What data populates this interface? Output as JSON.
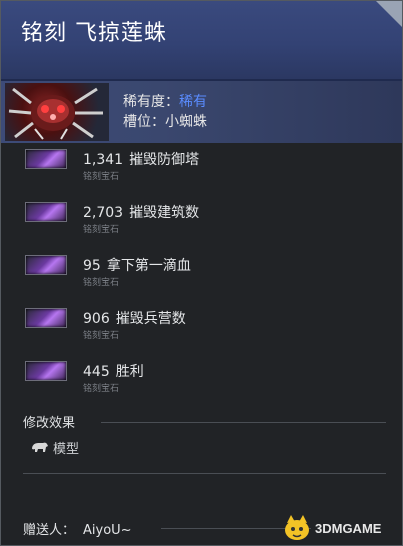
{
  "item": {
    "title": "铭刻 飞掠莲蛛",
    "rarity_label": "稀有度：",
    "rarity_value": "稀有",
    "slot_label": "槽位：",
    "slot_value": "小蜘蛛"
  },
  "gems": [
    {
      "count": "1,341",
      "name": "摧毁防御塔",
      "type": "铭刻宝石"
    },
    {
      "count": "2,703",
      "name": "摧毁建筑数",
      "type": "铭刻宝石"
    },
    {
      "count": "95",
      "name": "拿下第一滴血",
      "type": "铭刻宝石"
    },
    {
      "count": "906",
      "name": "摧毁兵营数",
      "type": "铭刻宝石"
    },
    {
      "count": "445",
      "name": "胜利",
      "type": "铭刻宝石"
    }
  ],
  "modifiers": {
    "title": "修改效果",
    "items": [
      {
        "label": "模型",
        "icon": "bear-icon"
      }
    ]
  },
  "gifter": {
    "label": "赠送人：",
    "name": "AiyoU~"
  },
  "watermark": {
    "text": "3DMGAME"
  },
  "colors": {
    "rarity": "#5a8cff",
    "header": "#334274"
  }
}
